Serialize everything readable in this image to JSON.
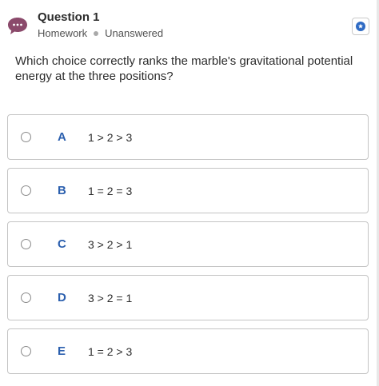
{
  "question": {
    "title": "Question 1",
    "category": "Homework",
    "status": "Unanswered",
    "prompt": "Which choice correctly ranks the marble's gravitational potential energy at the three positions?"
  },
  "icons": {
    "chat": "chat-bubble-icon",
    "bookmark": "star-icon"
  },
  "colors": {
    "chat_icon": "#8b4a6b",
    "accent": "#2b5fae",
    "star_badge": "#2f6bc4",
    "border": "#c4c4c4"
  },
  "options": [
    {
      "letter": "A",
      "text": "1 > 2 > 3"
    },
    {
      "letter": "B",
      "text": "1 = 2 = 3"
    },
    {
      "letter": "C",
      "text": "3 > 2 > 1"
    },
    {
      "letter": "D",
      "text": "3 > 2 = 1"
    },
    {
      "letter": "E",
      "text": "1 = 2 > 3"
    }
  ]
}
